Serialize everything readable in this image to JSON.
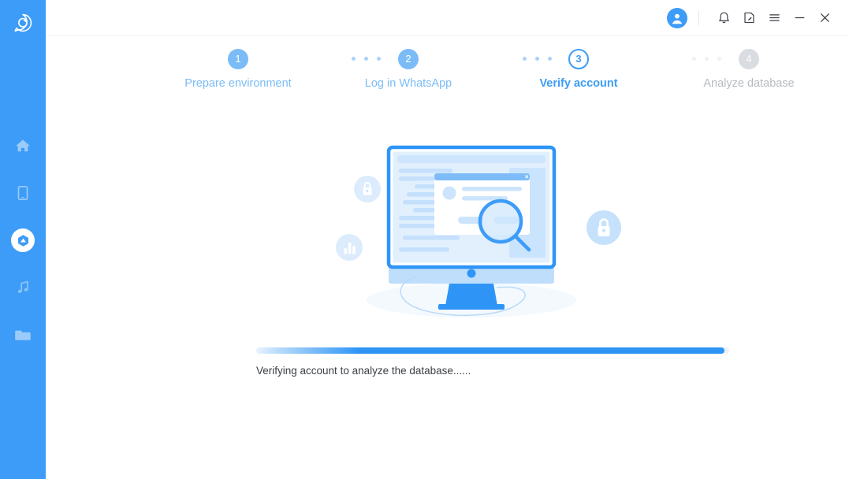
{
  "app": {
    "logo_icon": "chat-bubble-refresh-logo",
    "accent_color": "#3d9cf8",
    "sidebar_color": "#3d9cf8"
  },
  "sidebar": {
    "items": [
      {
        "name": "home",
        "icon": "home-icon",
        "active": false
      },
      {
        "name": "device",
        "icon": "phone-icon",
        "active": false
      },
      {
        "name": "recover",
        "icon": "recover-cloud-icon",
        "active": true
      },
      {
        "name": "music",
        "icon": "music-note-icon",
        "active": false
      },
      {
        "name": "files",
        "icon": "folder-icon",
        "active": false
      }
    ]
  },
  "titlebar": {
    "avatar_icon": "user-avatar-icon",
    "buttons": [
      {
        "name": "notifications",
        "icon": "bell-icon"
      },
      {
        "name": "feedback",
        "icon": "note-edit-icon"
      },
      {
        "name": "menu",
        "icon": "hamburger-menu-icon"
      },
      {
        "name": "minimize",
        "icon": "minimize-icon"
      },
      {
        "name": "close",
        "icon": "close-icon"
      }
    ]
  },
  "stepper": {
    "steps": [
      {
        "number": "1",
        "label": "Prepare environment",
        "state": "done"
      },
      {
        "number": "2",
        "label": "Log in WhatsApp",
        "state": "done"
      },
      {
        "number": "3",
        "label": "Verify account",
        "state": "active"
      },
      {
        "number": "4",
        "label": "Analyze database",
        "state": "todo"
      }
    ],
    "connectors": [
      {
        "state": "on"
      },
      {
        "state": "on"
      },
      {
        "state": "off"
      }
    ]
  },
  "illustration": {
    "name": "monitor-search-illustration",
    "badges": [
      {
        "name": "lock-badge-small",
        "icon": "lock-icon"
      },
      {
        "name": "chart-badge",
        "icon": "bar-chart-icon"
      },
      {
        "name": "lock-badge-large",
        "icon": "lock-icon"
      }
    ],
    "magnifier_icon": "magnifying-glass-icon"
  },
  "progress": {
    "percent": 99,
    "status_text": "Verifying account to analyze the database......",
    "fill_color": "#2e95f7",
    "track_color": "#eef1f4"
  }
}
